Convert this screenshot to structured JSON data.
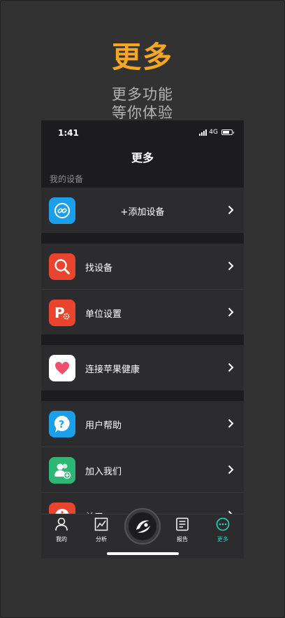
{
  "promo": {
    "title": "更多",
    "subtitle_line1": "更多功能",
    "subtitle_line2": "等你体验"
  },
  "status_bar": {
    "time": "1:41",
    "network": "4G"
  },
  "header": {
    "title": "更多"
  },
  "sections": {
    "my_devices_label": "我的设备"
  },
  "menu": {
    "add_device": {
      "label": "+添加设备",
      "icon": "watch-link-icon",
      "color": "#1a9fe8"
    },
    "find_device": {
      "label": "找设备",
      "icon": "magnifier-icon",
      "color": "#e8442e"
    },
    "unit_settings": {
      "label": "单位设置",
      "icon": "p-gear-icon",
      "color": "#e8442e"
    },
    "apple_health": {
      "label": "连接苹果健康",
      "icon": "heart-icon",
      "color": "#ffffff"
    },
    "user_help": {
      "label": "用户帮助",
      "icon": "question-bubble-icon",
      "color": "#1a9fe8"
    },
    "join_us": {
      "label": "加入我们",
      "icon": "add-people-icon",
      "color": "#2cb774"
    },
    "about": {
      "label": "关于",
      "icon": "info-icon",
      "color": "#e8442e"
    }
  },
  "tabbar": {
    "mine": "我的",
    "analysis": "分析",
    "report": "报告",
    "more": "更多",
    "accent": "#2ad0c0"
  }
}
